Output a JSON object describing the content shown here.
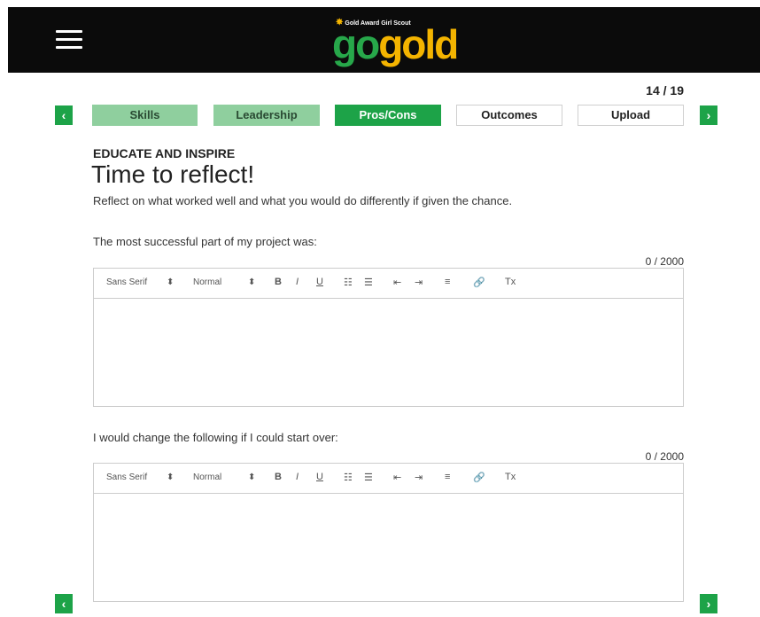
{
  "header": {
    "logo_small": "Gold Award Girl Scout",
    "logo_go": "go",
    "logo_gold": "gold"
  },
  "progress": {
    "page_count": "14 / 19"
  },
  "nav": {
    "prev_label": "‹",
    "next_label": "›"
  },
  "tabs": [
    {
      "label": "Skills",
      "state": "done"
    },
    {
      "label": "Leadership",
      "state": "done"
    },
    {
      "label": "Pros/Cons",
      "state": "active"
    },
    {
      "label": "Outcomes",
      "state": "todo"
    },
    {
      "label": "Upload",
      "state": "todo"
    }
  ],
  "section": {
    "label": "EDUCATE AND INSPIRE",
    "title": "Time to reflect!",
    "subtitle": "Reflect on what worked well and what you would do differently if given the chance."
  },
  "toolbar": {
    "font": "Sans Serif",
    "size": "Normal",
    "select_arrow": "⬍",
    "bold": "B",
    "italic": "I",
    "underline": "U",
    "ordered_list": "☷",
    "bullet_list": "☰",
    "indent_decrease": "⇤",
    "indent_increase": "⇥",
    "align": "≡",
    "link": "🔗",
    "clear": "Tx"
  },
  "questions": [
    {
      "label": "The most successful part of my project was:",
      "counter": "0 / 2000",
      "value": ""
    },
    {
      "label": "I would change the following if I could start over:",
      "counter": "0 / 2000",
      "value": ""
    }
  ],
  "colors": {
    "green": "#1da348",
    "light_green": "#8fcf9e",
    "gold": "#f4b400",
    "header_bg": "#0b0b0b"
  }
}
